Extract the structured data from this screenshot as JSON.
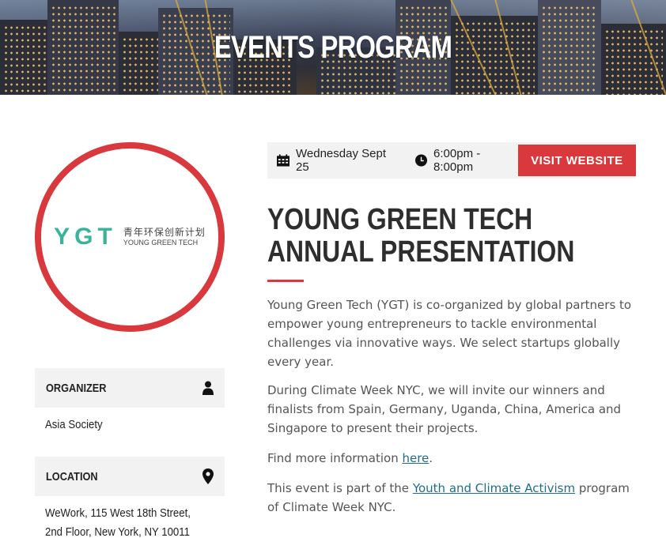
{
  "hero": {
    "title": "EVENTS PROGRAM"
  },
  "logo": {
    "letters": "YGT",
    "chinese": "青年环保创新计划",
    "english": "YOUNG GREEN TECH"
  },
  "organizer": {
    "label": "ORGANIZER",
    "value": "Asia Society",
    "icon": "person-icon"
  },
  "location": {
    "label": "LOCATION",
    "value": "WeWork, 115 West 18th Street, 2nd Floor, New York, NY 10011",
    "icon": "map-pin-icon"
  },
  "meta": {
    "date": "Wednesday Sept 25",
    "time": "6:00pm - 8:00pm",
    "visit_label": "VISIT WEBSITE"
  },
  "event": {
    "title": "YOUNG GREEN TECH ANNUAL PRESENTATION",
    "para1": "Young Green Tech (YGT) is co-organized by global partners to empower young entrepreneurs to tackle environmental challenges via innovative ways. We select startups globally every year.",
    "para2": "During Climate Week NYC, we will invite our winners and finalists from Spain, Germany, Uganda, China, America and Singapore to present their projects.",
    "para3_prefix": "Find more information ",
    "para3_link": "here",
    "para3_suffix": ".",
    "para4_prefix": "This event is part of the ",
    "para4_link": "Youth and Climate Activism",
    "para4_suffix": " program of Climate Week NYC."
  },
  "colors": {
    "accent": "#d9383d",
    "logo_green": "#3bb39a",
    "link": "#1e6e8a",
    "bar_bg": "#f2f2f2"
  }
}
